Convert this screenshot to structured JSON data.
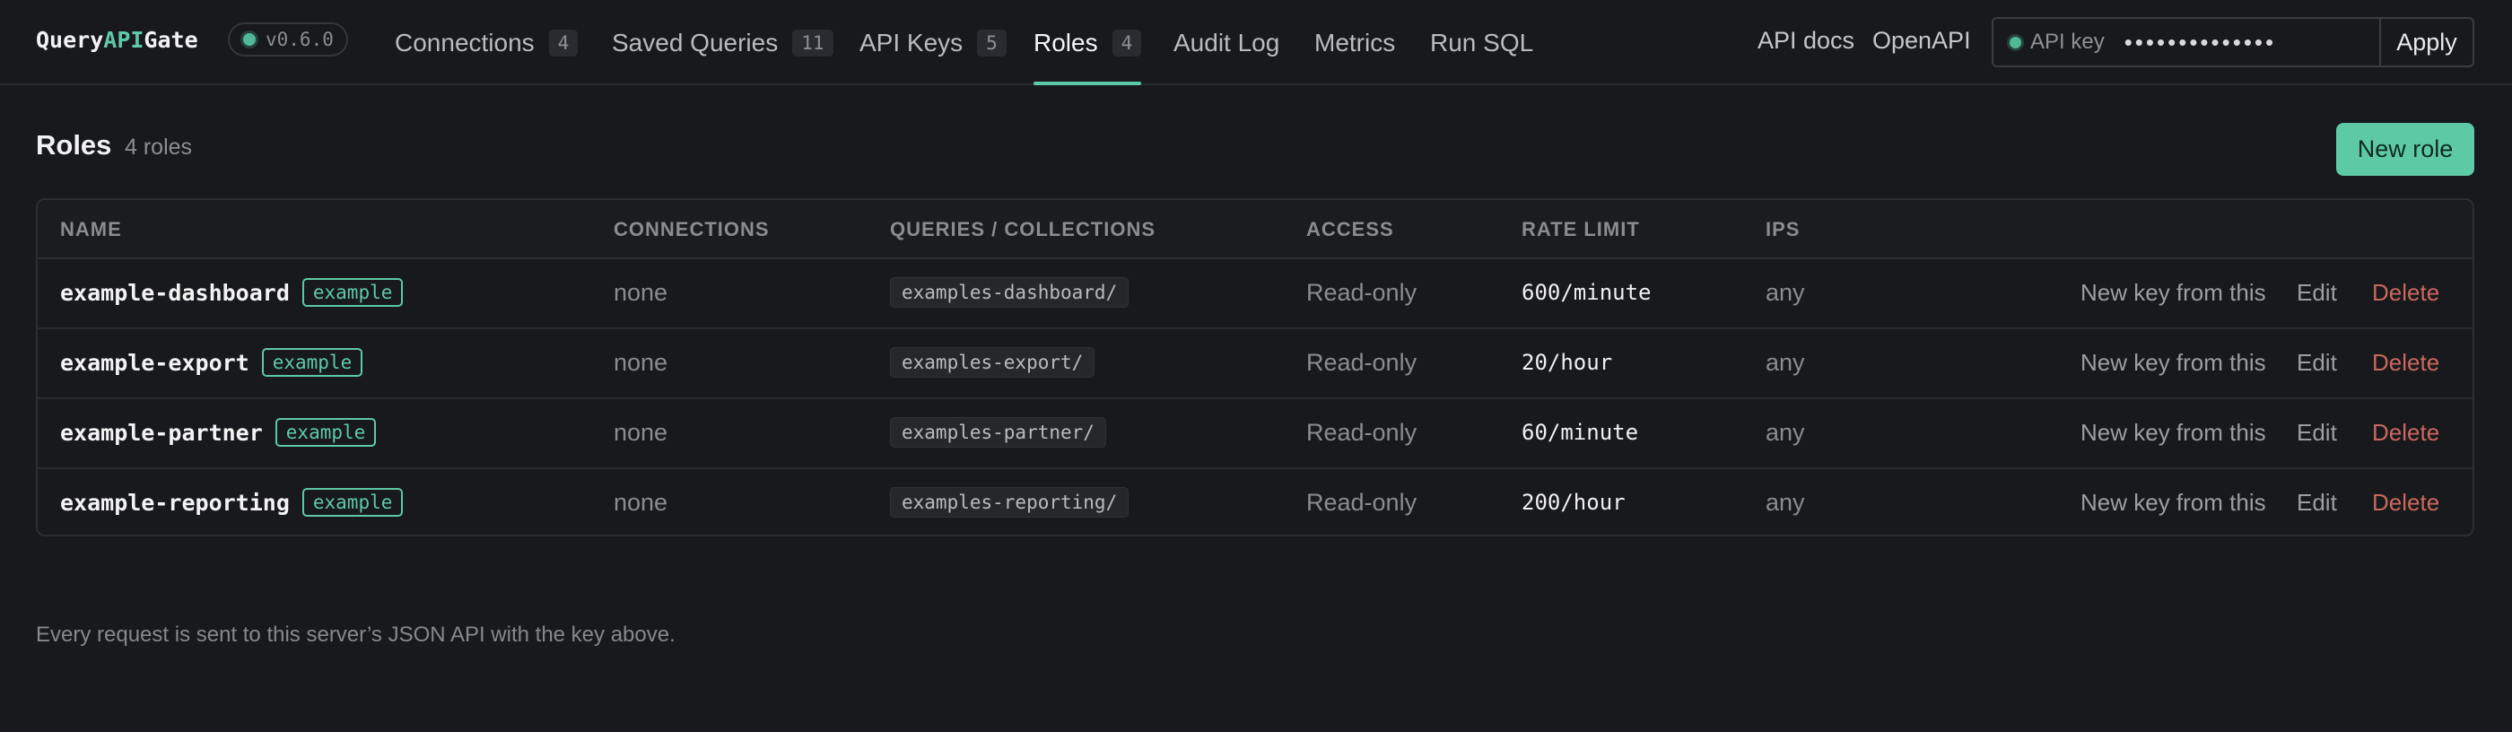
{
  "brand": {
    "prefix": "Query",
    "accent": "API",
    "suffix": "Gate",
    "version": "v0.6.0"
  },
  "nav": [
    {
      "label": "Connections",
      "count": "4"
    },
    {
      "label": "Saved Queries",
      "count": "11"
    },
    {
      "label": "API Keys",
      "count": "5"
    },
    {
      "label": "Roles",
      "count": "4",
      "active": true
    },
    {
      "label": "Audit Log"
    },
    {
      "label": "Metrics"
    },
    {
      "label": "Run SQL"
    }
  ],
  "header_links": {
    "api_docs": "API docs",
    "openapi": "OpenAPI"
  },
  "api_key": {
    "label": "API key",
    "value": "••••••••••••••",
    "apply": "Apply"
  },
  "page": {
    "title": "Roles",
    "subtitle": "4 roles",
    "new_button": "New role"
  },
  "table": {
    "columns": [
      "NAME",
      "CONNECTIONS",
      "QUERIES / COLLECTIONS",
      "ACCESS",
      "RATE LIMIT",
      "IPS"
    ],
    "rows": [
      {
        "name": "example-dashboard",
        "tag": "example",
        "connections": "none",
        "queries": "examples-dashboard/",
        "access": "Read-only",
        "rate": "600/minute",
        "ips": "any"
      },
      {
        "name": "example-export",
        "tag": "example",
        "connections": "none",
        "queries": "examples-export/",
        "access": "Read-only",
        "rate": "20/hour",
        "ips": "any"
      },
      {
        "name": "example-partner",
        "tag": "example",
        "connections": "none",
        "queries": "examples-partner/",
        "access": "Read-only",
        "rate": "60/minute",
        "ips": "any"
      },
      {
        "name": "example-reporting",
        "tag": "example",
        "connections": "none",
        "queries": "examples-reporting/",
        "access": "Read-only",
        "rate": "200/hour",
        "ips": "any"
      }
    ],
    "actions": {
      "new_key": "New key from this",
      "edit": "Edit",
      "delete": "Delete"
    }
  },
  "footer": {
    "note": "Every request is sent to this server’s JSON API with the key above."
  },
  "colors": {
    "accent": "#5ec9a5",
    "danger": "#c9685e",
    "background": "#18191c"
  }
}
